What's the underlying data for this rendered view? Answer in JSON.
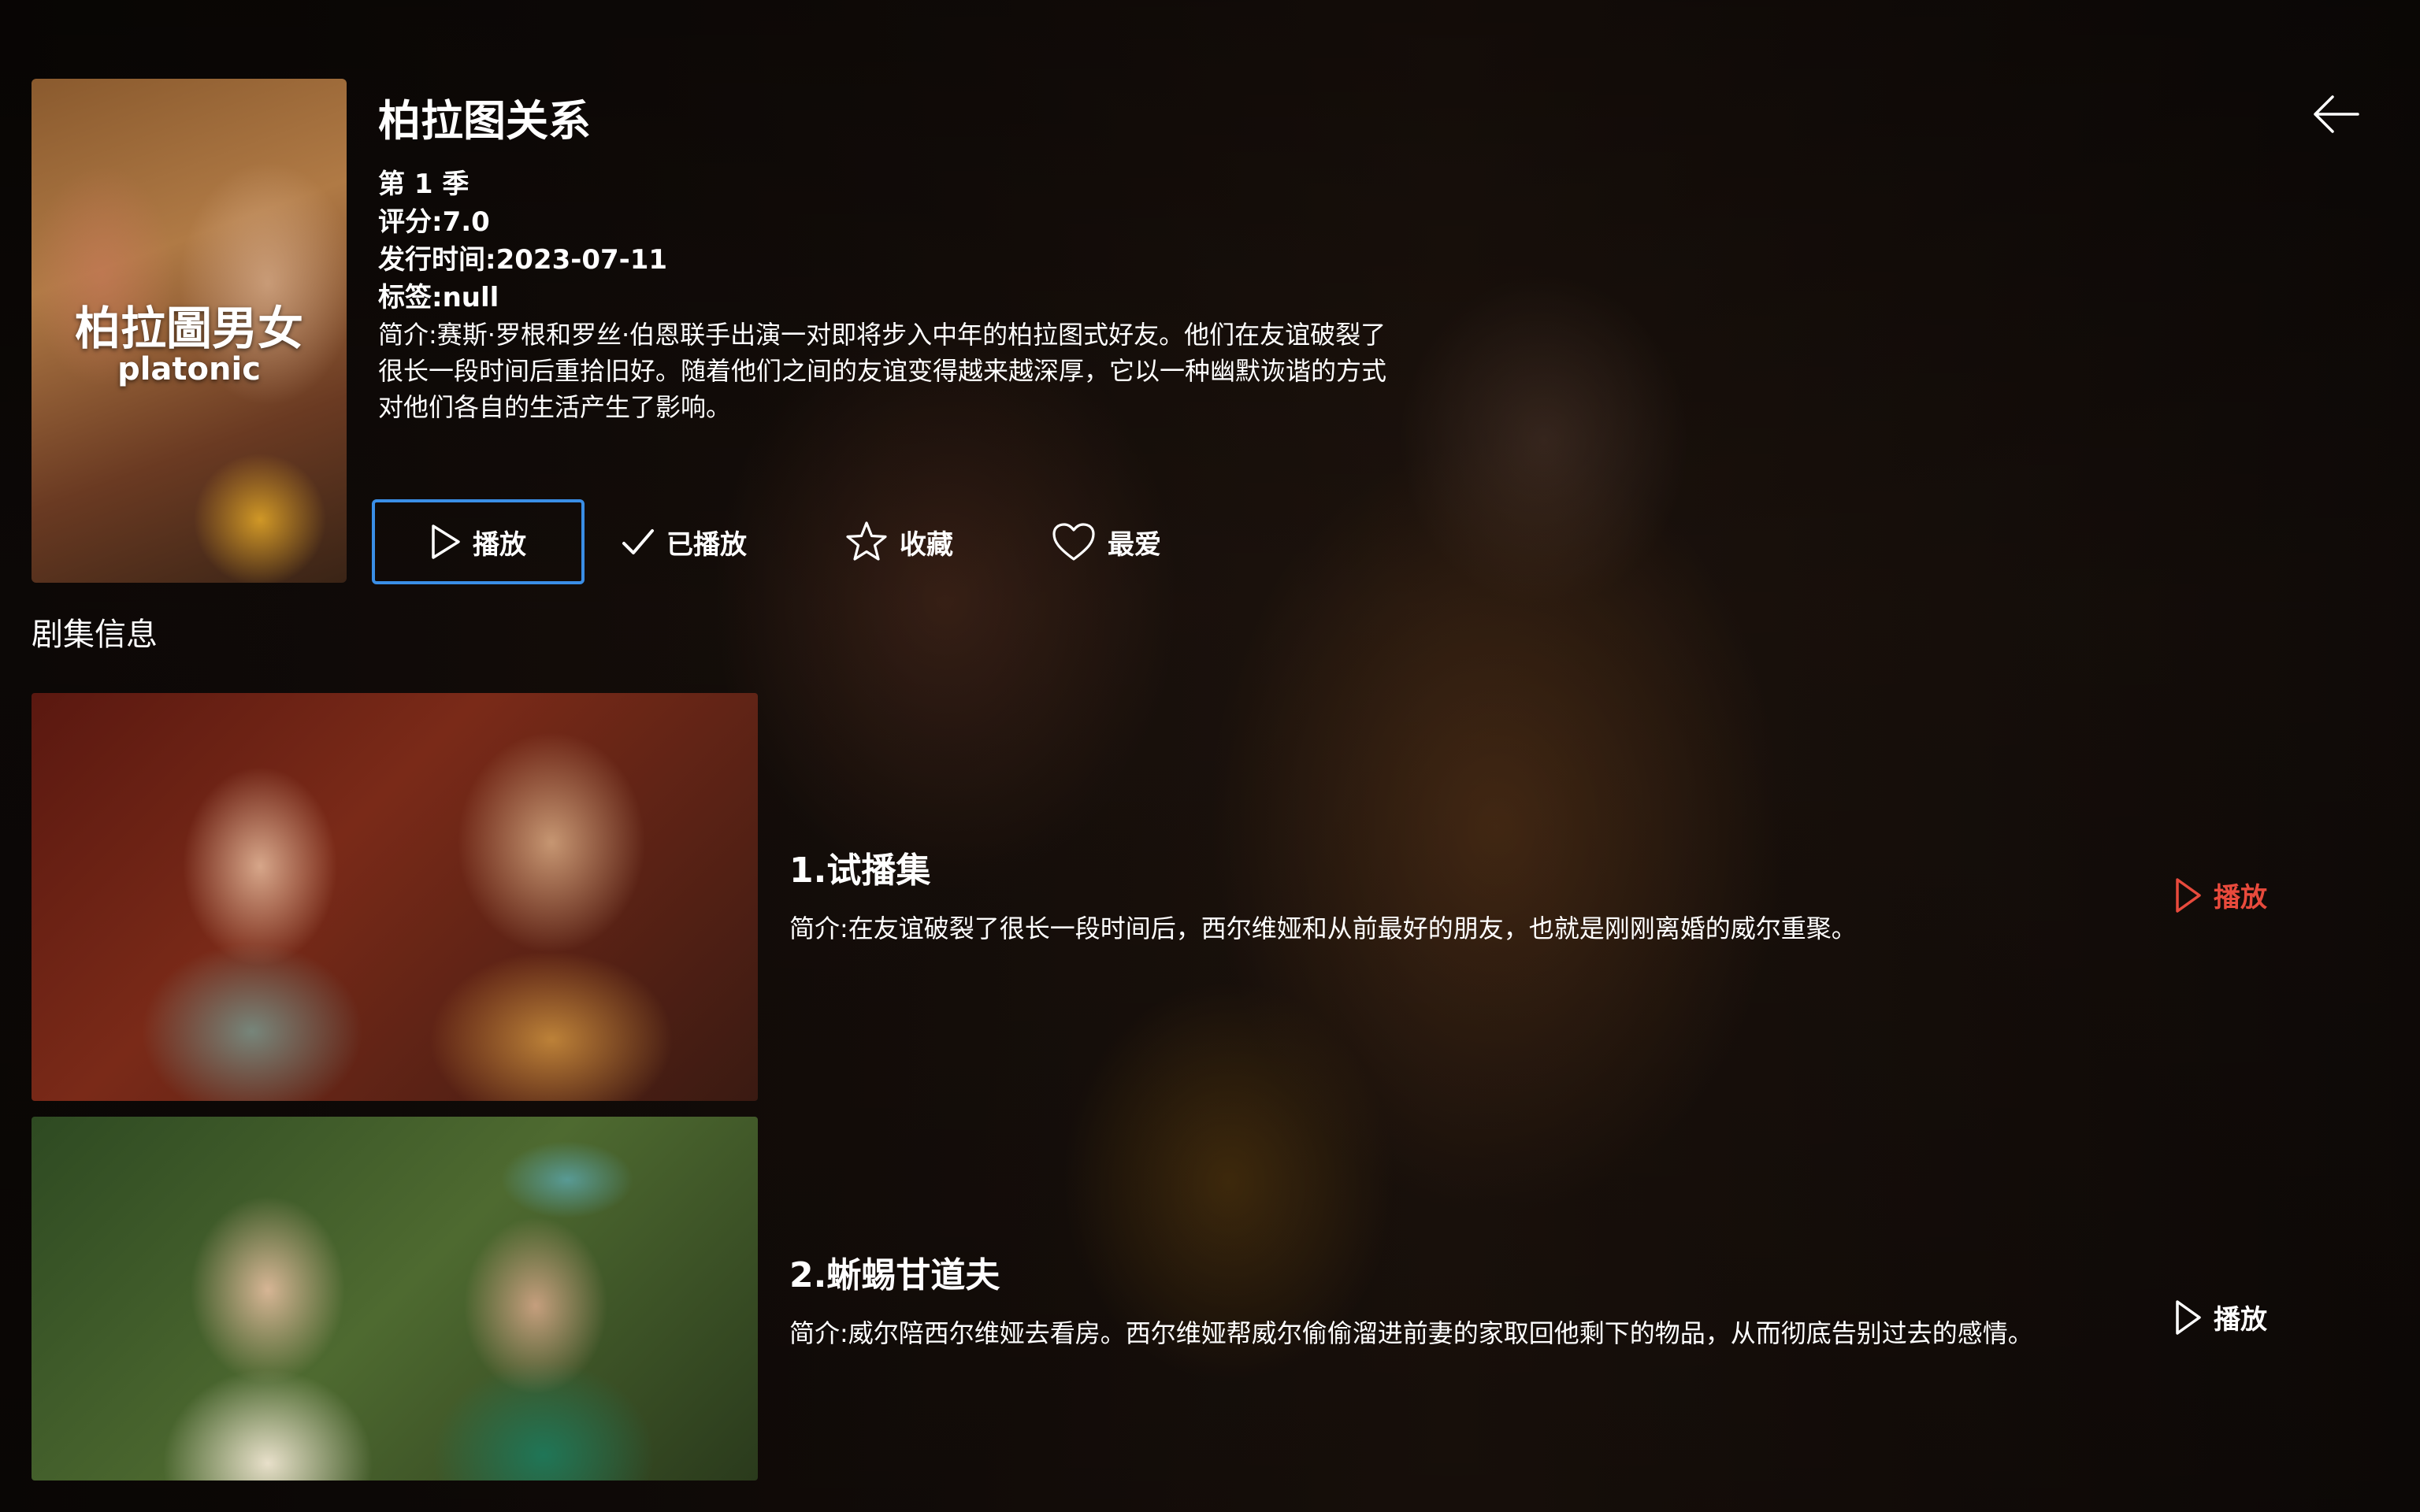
{
  "show": {
    "title": "柏拉图关系",
    "season": "第 1 季",
    "rating": "评分:7.0",
    "release_date": "发行时间:2023-07-11",
    "tags": "标签:null",
    "summary": "简介:赛斯·罗根和罗丝·伯恩联手出演一对即将步入中年的柏拉图式好友。他们在友谊破裂了很长一段时间后重拾旧好。随着他们之间的友谊变得越来越深厚，它以一种幽默诙谐的方式对他们各自的生活产生了影响。"
  },
  "poster": {
    "title_cn": "柏拉圖男女",
    "title_en": "platonic"
  },
  "actions": {
    "play": "播放",
    "played": "已播放",
    "collect": "收藏",
    "favorite": "最爱"
  },
  "icons": {
    "back": "back-arrow-icon",
    "play": "play-icon",
    "check": "check-icon",
    "star": "star-icon",
    "heart": "heart-icon"
  },
  "colors": {
    "focus_border": "#3a8ee6",
    "active_play": "#e84a3c",
    "text": "#ffffff"
  },
  "episodes_section": {
    "title": "剧集信息"
  },
  "episodes": [
    {
      "title": "1.试播集",
      "summary": "简介:在友谊破裂了很长一段时间后，西尔维娅和从前最好的朋友，也就是刚刚离婚的威尔重聚。",
      "play_label": "播放",
      "active": true
    },
    {
      "title": "2.蜥蜴甘道夫",
      "summary": "简介:威尔陪西尔维娅去看房。西尔维娅帮威尔偷偷溜进前妻的家取回他剩下的物品，从而彻底告别过去的感情。",
      "play_label": "播放",
      "active": false
    }
  ]
}
